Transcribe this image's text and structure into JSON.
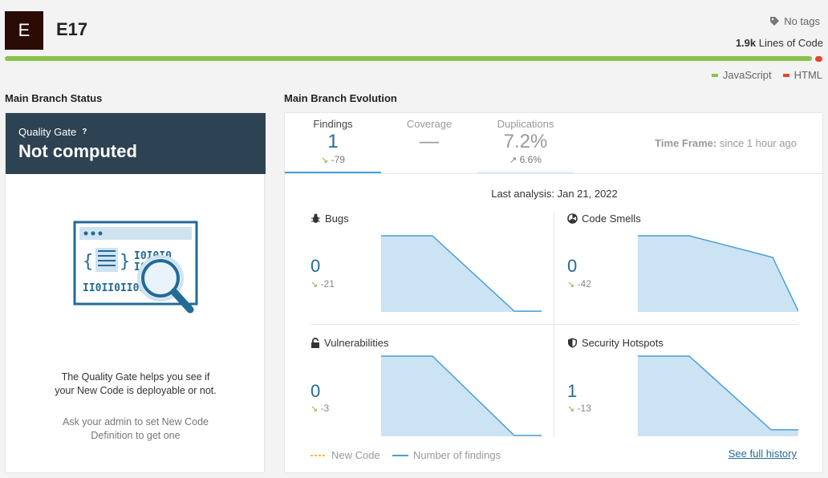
{
  "project": {
    "avatar_letter": "E",
    "name": "E17"
  },
  "tags_label": "No tags",
  "lines_of_code": {
    "value": "1.9k",
    "label": "Lines of Code"
  },
  "languages": [
    {
      "name": "JavaScript",
      "color": "#8bc34a"
    },
    {
      "name": "HTML",
      "color": "#e4472b"
    }
  ],
  "status_section": {
    "title": "Main Branch Status"
  },
  "quality_gate": {
    "label": "Quality Gate",
    "help": "?",
    "status": "Not computed",
    "text_line1": "The Quality Gate helps you see if",
    "text_line2": "your New Code is deployable or not.",
    "admin_line1": "Ask your admin to set New Code",
    "admin_line2": "Definition to get one"
  },
  "evolution_section": {
    "title": "Main Branch Evolution"
  },
  "tabs": [
    {
      "label": "Findings",
      "value": "1",
      "delta": "-79",
      "active": true,
      "accent": "#4b9fd5"
    },
    {
      "label": "Coverage",
      "value": "—",
      "delta": "",
      "active": false,
      "accent": ""
    },
    {
      "label": "Duplications",
      "value": "7.2%",
      "delta": "6.6%",
      "active": false,
      "accent": "#dfeef9"
    }
  ],
  "time_frame": {
    "label": "Time Frame:",
    "value": "since 1 hour ago"
  },
  "last_analysis": "Last analysis: Jan 21, 2022",
  "metrics": [
    {
      "name": "Bugs",
      "icon": "bug-icon",
      "value": "0",
      "delta": "-21"
    },
    {
      "name": "Code Smells",
      "icon": "code-smell-icon",
      "value": "0",
      "delta": "-42"
    },
    {
      "name": "Vulnerabilities",
      "icon": "lock-icon",
      "value": "0",
      "delta": "-3"
    },
    {
      "name": "Security Hotspots",
      "icon": "shield-icon",
      "value": "1",
      "delta": "-13"
    }
  ],
  "chart_data": [
    {
      "type": "area",
      "title": "Bugs",
      "series": [
        {
          "name": "Number of findings",
          "values": [
            21,
            21,
            21,
            0,
            0
          ]
        }
      ]
    },
    {
      "type": "area",
      "title": "Code Smells",
      "series": [
        {
          "name": "Number of findings",
          "values": [
            42,
            42,
            42,
            30,
            0
          ]
        }
      ]
    },
    {
      "type": "area",
      "title": "Vulnerabilities",
      "series": [
        {
          "name": "Number of findings",
          "values": [
            3,
            3,
            3,
            0,
            0
          ]
        }
      ]
    },
    {
      "type": "area",
      "title": "Security Hotspots",
      "series": [
        {
          "name": "Number of findings",
          "values": [
            14,
            14,
            14,
            1,
            1
          ]
        }
      ]
    }
  ],
  "legend": {
    "new_code": "New Code",
    "findings": "Number of findings",
    "new_code_color": "#f4a700",
    "findings_color": "#4b9fd5"
  },
  "see_history": "See full history",
  "colors": {
    "accent": "#236a97",
    "area_fill": "#cce3f3",
    "area_line": "#4b9fd5",
    "qg_header": "#2d4252"
  }
}
